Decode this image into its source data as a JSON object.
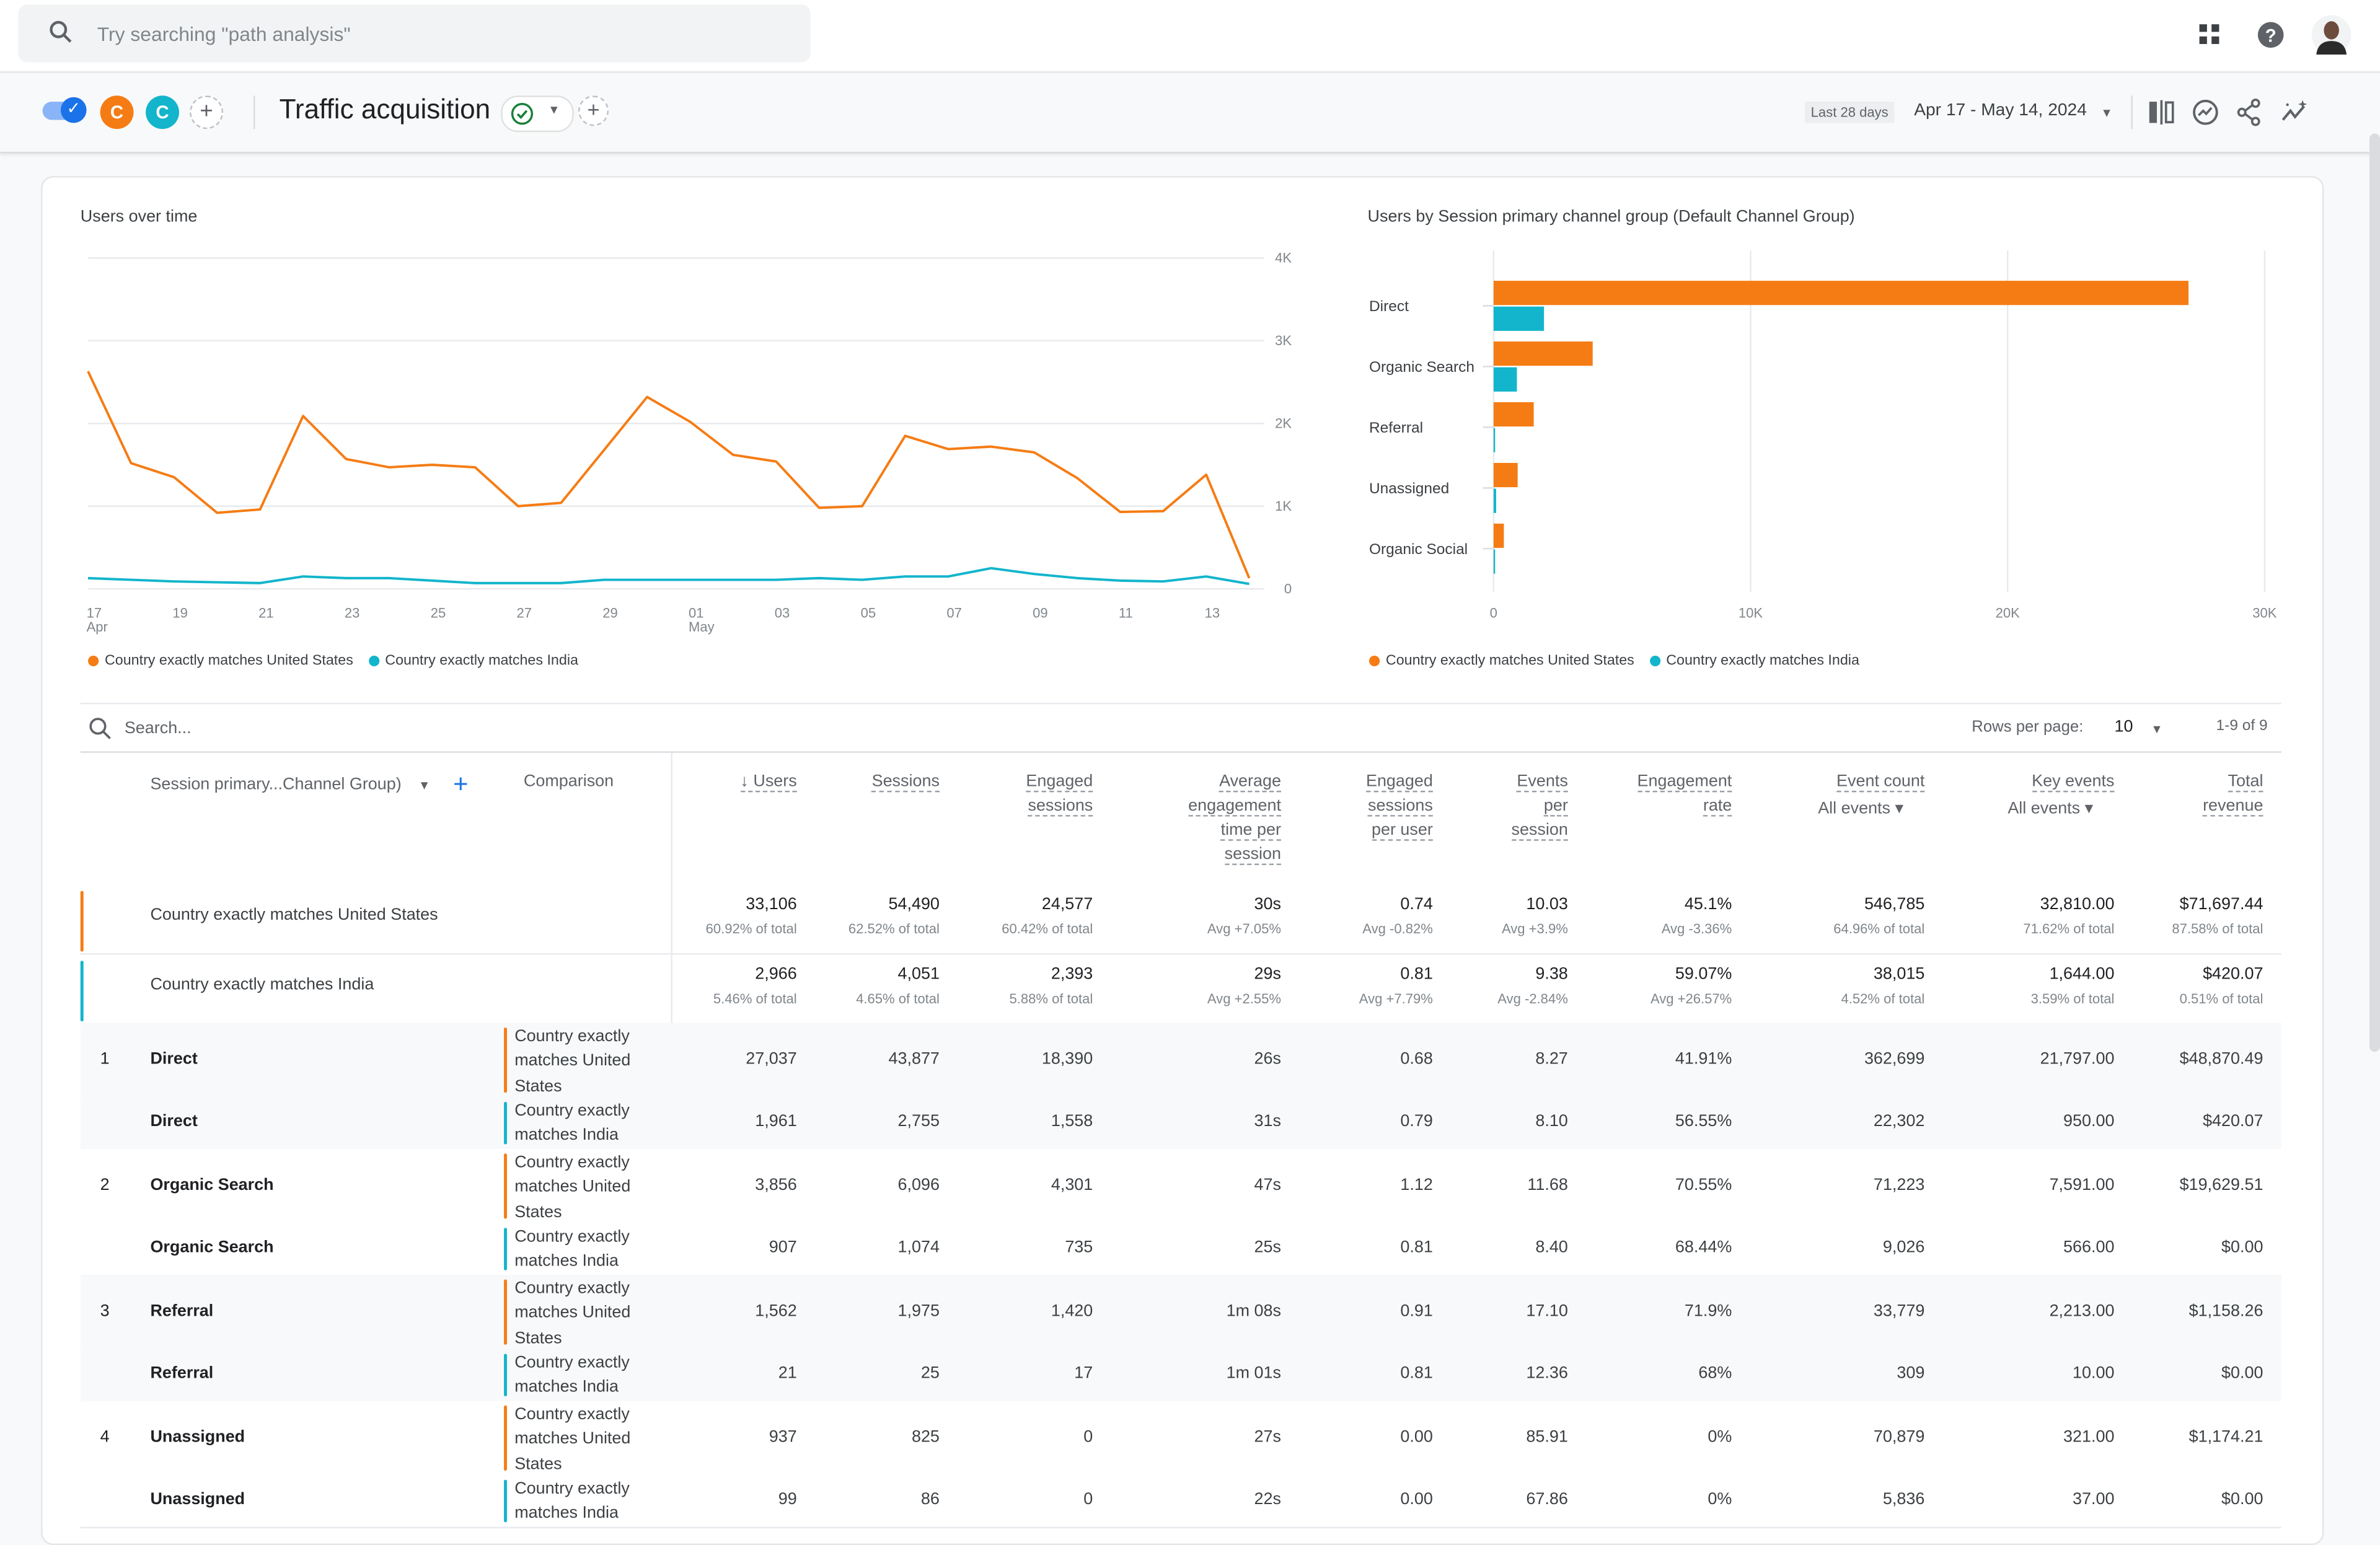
{
  "topbar": {
    "search_placeholder": "Try searching \"path analysis\"",
    "icons": [
      "apps-grid-icon",
      "help-icon",
      "account-avatar"
    ]
  },
  "subbar": {
    "comparison_chips": [
      {
        "letter": "C",
        "color": "#f57c14"
      },
      {
        "letter": "C",
        "color": "#12b5cb"
      }
    ],
    "report_title": "Traffic acquisition",
    "date_preset": "Last 28 days",
    "date_range": "Apr 17 - May 14, 2024",
    "icons": [
      "compare-icon",
      "insights-icon",
      "share-icon",
      "ai-sparkle-chart-icon"
    ]
  },
  "colors": {
    "us": "#f57c14",
    "india": "#12b5cb",
    "accent": "#1a73e8"
  },
  "chart_data": [
    {
      "type": "line",
      "title": "Users over time",
      "xlabel": "",
      "ylabel": "",
      "ylim": [
        0,
        4000
      ],
      "yticks": [
        "0",
        "1K",
        "2K",
        "3K",
        "4K"
      ],
      "x": [
        "Apr 17",
        "Apr 18",
        "Apr 19",
        "Apr 20",
        "Apr 21",
        "Apr 22",
        "Apr 23",
        "Apr 24",
        "Apr 25",
        "Apr 26",
        "Apr 27",
        "Apr 28",
        "Apr 29",
        "Apr 30",
        "May 01",
        "May 02",
        "May 03",
        "May 04",
        "May 05",
        "May 06",
        "May 07",
        "May 08",
        "May 09",
        "May 10",
        "May 11",
        "May 12",
        "May 13",
        "May 14"
      ],
      "xtick_labels": [
        {
          "label": "17",
          "sub": "Apr",
          "index": 0
        },
        {
          "label": "19",
          "index": 2
        },
        {
          "label": "21",
          "index": 4
        },
        {
          "label": "23",
          "index": 6
        },
        {
          "label": "25",
          "index": 8
        },
        {
          "label": "27",
          "index": 10
        },
        {
          "label": "29",
          "index": 12
        },
        {
          "label": "01",
          "sub": "May",
          "index": 14
        },
        {
          "label": "03",
          "index": 16
        },
        {
          "label": "05",
          "index": 18
        },
        {
          "label": "07",
          "index": 20
        },
        {
          "label": "09",
          "index": 22
        },
        {
          "label": "11",
          "index": 24
        },
        {
          "label": "13",
          "index": 26
        }
      ],
      "series": [
        {
          "name": "Country exactly matches United States",
          "color": "#f57c14",
          "values": [
            2630,
            1520,
            1350,
            920,
            960,
            2090,
            1570,
            1470,
            1500,
            1470,
            1000,
            1040,
            1680,
            2320,
            2020,
            1620,
            1540,
            980,
            1000,
            1850,
            1690,
            1720,
            1650,
            1340,
            930,
            940,
            1380,
            130
          ]
        },
        {
          "name": "Country exactly matches India",
          "color": "#12b5cb",
          "values": [
            130,
            110,
            90,
            80,
            70,
            150,
            130,
            130,
            100,
            70,
            70,
            70,
            110,
            110,
            110,
            110,
            110,
            130,
            110,
            150,
            150,
            250,
            180,
            130,
            100,
            90,
            150,
            60
          ]
        }
      ],
      "legend": "bottom-left",
      "grid": true
    },
    {
      "type": "bar",
      "orientation": "horizontal",
      "title": "Users by Session primary channel group (Default Channel Group)",
      "categories": [
        "Direct",
        "Organic Search",
        "Referral",
        "Unassigned",
        "Organic Social"
      ],
      "xlim": [
        0,
        30000
      ],
      "xticks": [
        "0",
        "10K",
        "20K",
        "30K"
      ],
      "series": [
        {
          "name": "Country exactly matches United States",
          "color": "#f57c14",
          "values": [
            27037,
            3856,
            1562,
            937,
            400
          ]
        },
        {
          "name": "Country exactly matches India",
          "color": "#12b5cb",
          "values": [
            1961,
            907,
            21,
            99,
            15
          ]
        }
      ],
      "legend": "bottom-left",
      "grid": true
    }
  ],
  "table": {
    "search_placeholder": "Search...",
    "rows_per_page_label": "Rows per page:",
    "rows_per_page": "10",
    "pagination": "1-9 of 9",
    "dimension_header": "Session primary...Channel Group)",
    "comparison_header": "Comparison",
    "columns": [
      {
        "lines": [
          "↓ Users"
        ]
      },
      {
        "lines": [
          "Sessions"
        ]
      },
      {
        "lines": [
          "Engaged",
          "sessions"
        ]
      },
      {
        "lines": [
          "Average",
          "engagement",
          "time per",
          "session"
        ]
      },
      {
        "lines": [
          "Engaged",
          "sessions",
          "per user"
        ]
      },
      {
        "lines": [
          "Events",
          "per",
          "session"
        ]
      },
      {
        "lines": [
          "Engagement",
          "rate"
        ]
      },
      {
        "lines": [
          "Event count"
        ],
        "filter": "All events"
      },
      {
        "lines": [
          "Key events"
        ],
        "filter": "All events"
      },
      {
        "lines": [
          "Total",
          "revenue"
        ]
      }
    ],
    "totals": [
      {
        "label": "Country exactly matches United States",
        "color": "#f57c14",
        "values": [
          "33,106",
          "54,490",
          "24,577",
          "30s",
          "0.74",
          "10.03",
          "45.1%",
          "546,785",
          "32,810.00",
          "$71,697.44"
        ],
        "subs": [
          "60.92% of total",
          "62.52% of total",
          "60.42% of total",
          "Avg +7.05%",
          "Avg -0.82%",
          "Avg +3.9%",
          "Avg -3.36%",
          "64.96% of total",
          "71.62% of total",
          "87.58% of total"
        ]
      },
      {
        "label": "Country exactly matches India",
        "color": "#12b5cb",
        "values": [
          "2,966",
          "4,051",
          "2,393",
          "29s",
          "0.81",
          "9.38",
          "59.07%",
          "38,015",
          "1,644.00",
          "$420.07"
        ],
        "subs": [
          "5.46% of total",
          "4.65% of total",
          "5.88% of total",
          "Avg +2.55%",
          "Avg +7.79%",
          "Avg -2.84%",
          "Avg +26.57%",
          "4.52% of total",
          "3.59% of total",
          "0.51% of total"
        ]
      }
    ],
    "rows": [
      {
        "num": "1",
        "dim": "Direct",
        "cmp": [
          "Country exactly",
          "matches United",
          "States"
        ],
        "seg": "us",
        "values": [
          "27,037",
          "43,877",
          "18,390",
          "26s",
          "0.68",
          "8.27",
          "41.91%",
          "362,699",
          "21,797.00",
          "$48,870.49"
        ]
      },
      {
        "num": "",
        "dim": "Direct",
        "cmp": [
          "Country exactly",
          "matches India"
        ],
        "seg": "india",
        "values": [
          "1,961",
          "2,755",
          "1,558",
          "31s",
          "0.79",
          "8.10",
          "56.55%",
          "22,302",
          "950.00",
          "$420.07"
        ]
      },
      {
        "num": "2",
        "dim": "Organic Search",
        "cmp": [
          "Country exactly",
          "matches United",
          "States"
        ],
        "seg": "us",
        "values": [
          "3,856",
          "6,096",
          "4,301",
          "47s",
          "1.12",
          "11.68",
          "70.55%",
          "71,223",
          "7,591.00",
          "$19,629.51"
        ]
      },
      {
        "num": "",
        "dim": "Organic Search",
        "cmp": [
          "Country exactly",
          "matches India"
        ],
        "seg": "india",
        "values": [
          "907",
          "1,074",
          "735",
          "25s",
          "0.81",
          "8.40",
          "68.44%",
          "9,026",
          "566.00",
          "$0.00"
        ]
      },
      {
        "num": "3",
        "dim": "Referral",
        "cmp": [
          "Country exactly",
          "matches United",
          "States"
        ],
        "seg": "us",
        "values": [
          "1,562",
          "1,975",
          "1,420",
          "1m 08s",
          "0.91",
          "17.10",
          "71.9%",
          "33,779",
          "2,213.00",
          "$1,158.26"
        ]
      },
      {
        "num": "",
        "dim": "Referral",
        "cmp": [
          "Country exactly",
          "matches India"
        ],
        "seg": "india",
        "values": [
          "21",
          "25",
          "17",
          "1m 01s",
          "0.81",
          "12.36",
          "68%",
          "309",
          "10.00",
          "$0.00"
        ]
      },
      {
        "num": "4",
        "dim": "Unassigned",
        "cmp": [
          "Country exactly",
          "matches United",
          "States"
        ],
        "seg": "us",
        "values": [
          "937",
          "825",
          "0",
          "27s",
          "0.00",
          "85.91",
          "0%",
          "70,879",
          "321.00",
          "$1,174.21"
        ]
      },
      {
        "num": "",
        "dim": "Unassigned",
        "cmp": [
          "Country exactly",
          "matches India"
        ],
        "seg": "india",
        "values": [
          "99",
          "86",
          "0",
          "22s",
          "0.00",
          "67.86",
          "0%",
          "5,836",
          "37.00",
          "$0.00"
        ]
      }
    ]
  }
}
